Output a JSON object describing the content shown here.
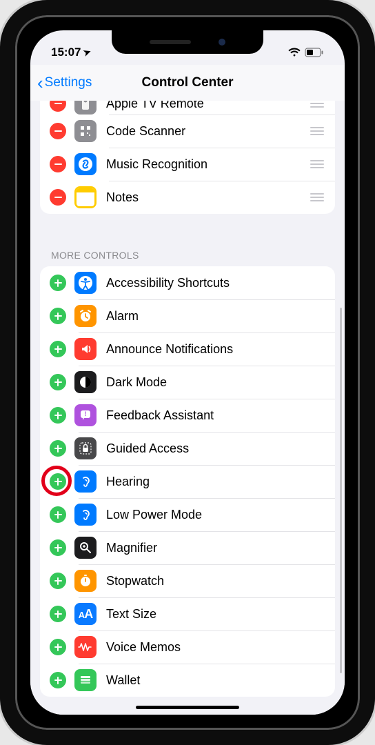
{
  "status": {
    "time": "15:07",
    "location_arrow": "➤"
  },
  "nav": {
    "back_label": "Settings",
    "title": "Control Center"
  },
  "included_partial": [
    {
      "label": "Apple TV Remote",
      "icon": "remote",
      "color": "ic-gray"
    },
    {
      "label": "Code Scanner",
      "icon": "qr",
      "color": "ic-gray"
    },
    {
      "label": "Music Recognition",
      "icon": "shazam",
      "color": "ic-blue"
    },
    {
      "label": "Notes",
      "icon": "notes",
      "color": "ic-yellow"
    }
  ],
  "section_header": "MORE CONTROLS",
  "more": [
    {
      "label": "Accessibility Shortcuts",
      "icon": "accessibility",
      "color": "ic-blue"
    },
    {
      "label": "Alarm",
      "icon": "alarm",
      "color": "ic-orange"
    },
    {
      "label": "Announce Notifications",
      "icon": "announce",
      "color": "ic-red"
    },
    {
      "label": "Dark Mode",
      "icon": "darkmode",
      "color": "ic-black"
    },
    {
      "label": "Feedback Assistant",
      "icon": "feedback",
      "color": "ic-purple"
    },
    {
      "label": "Guided Access",
      "icon": "lock",
      "color": "ic-darkgray"
    },
    {
      "label": "Hearing",
      "icon": "ear",
      "color": "ic-blue",
      "highlight": true
    },
    {
      "label": "Low Power Mode",
      "icon": "ear2",
      "color": "ic-blue"
    },
    {
      "label": "Magnifier",
      "icon": "magnifier",
      "color": "ic-black"
    },
    {
      "label": "Stopwatch",
      "icon": "stopwatch",
      "color": "ic-orange"
    },
    {
      "label": "Text Size",
      "icon": "textsize",
      "color": "ic-bluealt"
    },
    {
      "label": "Voice Memos",
      "icon": "voicememo",
      "color": "ic-red"
    },
    {
      "label": "Wallet",
      "icon": "wallet",
      "color": "ic-green"
    }
  ]
}
